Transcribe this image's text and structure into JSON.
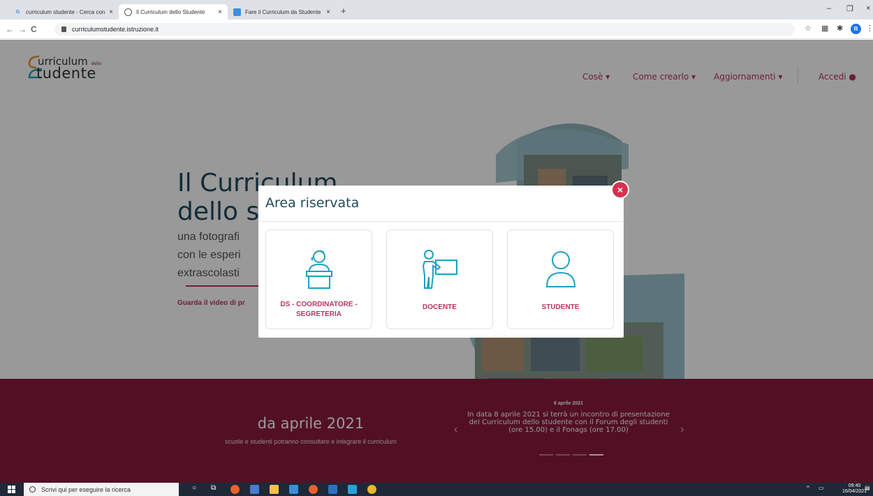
{
  "browser": {
    "tabs": [
      {
        "title": "curriculum studente - Cerca con",
        "favicon": "G"
      },
      {
        "title": "Il Curriculum dello Studente",
        "favicon": ""
      },
      {
        "title": "Fare il Curriculum da Studente in",
        "favicon": ""
      }
    ],
    "url": "curriculumstudente.istruzione.it",
    "profile_initial": "R"
  },
  "site": {
    "logo_line1": "urriculum",
    "logo_line1_small": "dello",
    "logo_line2": "tudente",
    "nav": {
      "cose": "Cosè",
      "come": "Come crearlo",
      "aggiornamenti": "Aggiornamenti",
      "accedi": "Accedi"
    },
    "hero": {
      "title_1": "Il Curriculum",
      "title_2": "dello s",
      "sub_1": "una fotografi",
      "sub_2": "con le esperi",
      "sub_3": "extrascolasti",
      "video_link": "Guarda il video di pr"
    },
    "banner": {
      "headline": "da aprile 2021",
      "subtext": "scuole e studenti potranno consultare e integrare il curriculum",
      "news_date": "6 aprile 2021",
      "news_text": "In data 8 aprile 2021 si terrà un incontro di presentazione del Curriculum dello studente con il Forum degli studenti (ore 15.00) e il Fonags (ore 17.00)"
    }
  },
  "modal": {
    "title": "Area riservata",
    "close": "×",
    "cards": [
      {
        "label": "DS - COORDINATORE - SEGRETERIA",
        "icon": "receptionist-icon"
      },
      {
        "label": "DOCENTE",
        "icon": "teacher-icon"
      },
      {
        "label": "STUDENTE",
        "icon": "user-icon"
      }
    ]
  },
  "taskbar": {
    "search_placeholder": "Scrivi qui per eseguire la ricerca",
    "time": "09:40",
    "date": "16/04/2021"
  },
  "colors": {
    "accent": "#b8365c",
    "banner": "#8a1c3e",
    "icon_teal": "#1ea0c0",
    "title_dark": "#1f4a5e",
    "close": "#d9304e"
  }
}
